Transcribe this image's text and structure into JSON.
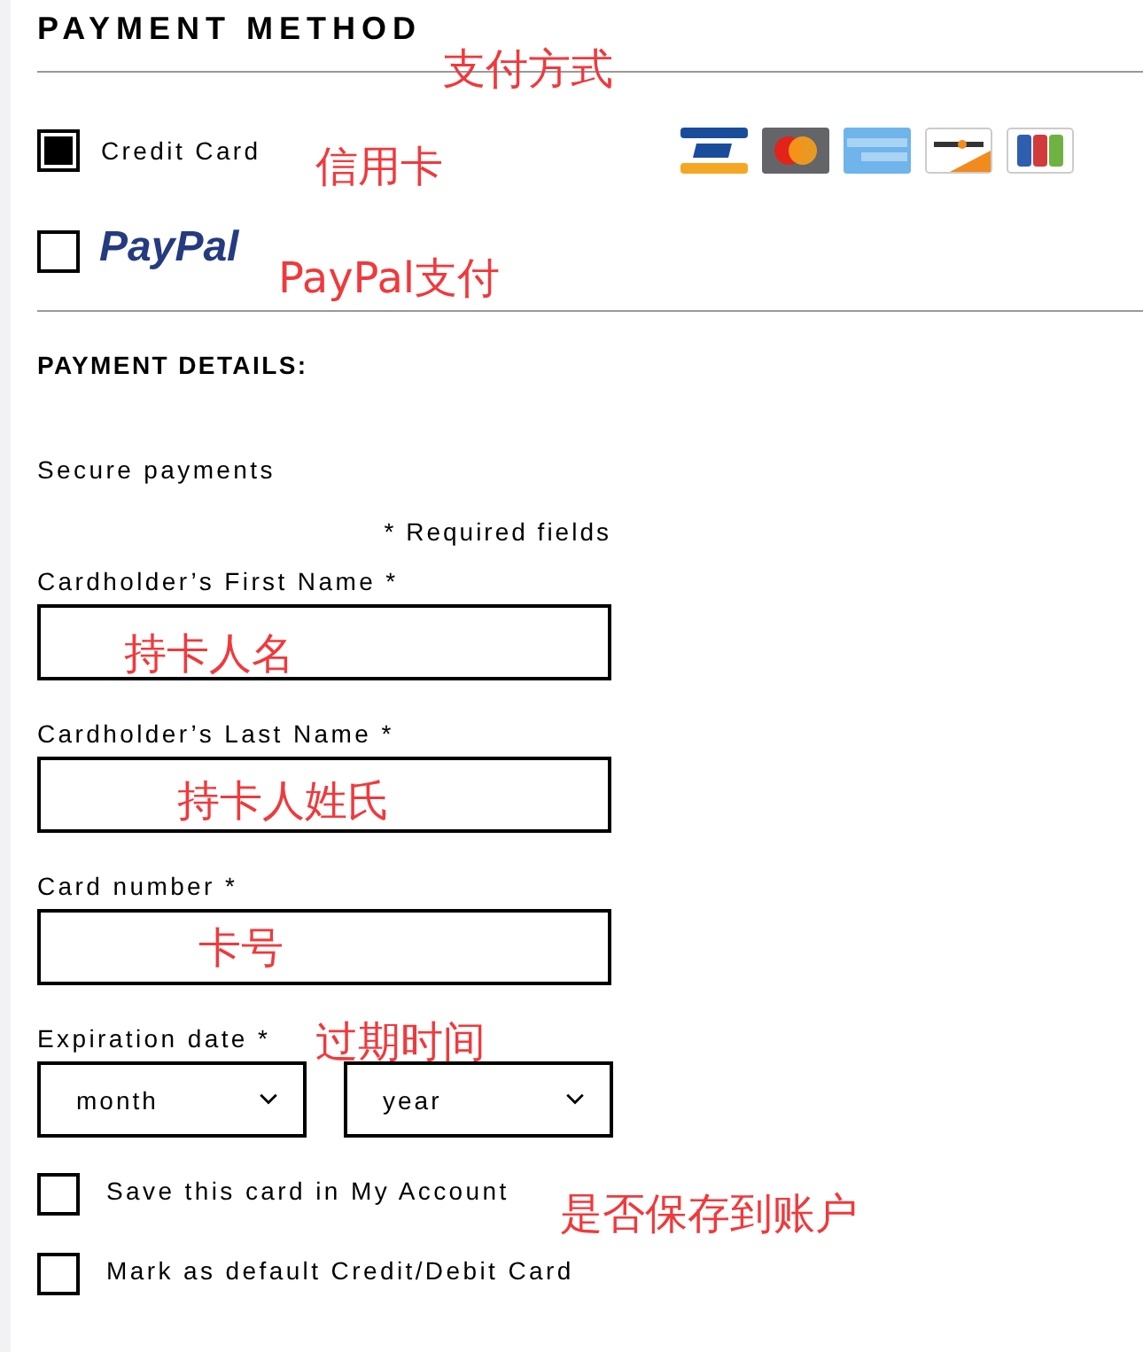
{
  "section_title": "PAYMENT METHOD",
  "methods": [
    {
      "kind": "card",
      "label": "Credit Card",
      "selected": true
    },
    {
      "kind": "paypal",
      "label": "PayPal",
      "selected": false
    }
  ],
  "details_title": "PAYMENT DETAILS:",
  "secure_note": "Secure payments",
  "required_note": "* Required fields",
  "fields": [
    {
      "label": "Cardholder’s First Name *"
    },
    {
      "label": "Cardholder’s Last Name *"
    },
    {
      "label": "Card number *"
    }
  ],
  "expiration": {
    "label": "Expiration date *",
    "selects": [
      {
        "value": "month"
      },
      {
        "value": "year"
      }
    ]
  },
  "options": [
    {
      "label": "Save this card in My Account",
      "checked": false
    },
    {
      "label": "Mark as default Credit/Debit Card",
      "checked": false
    }
  ],
  "annotations": [
    {
      "text": "支付方式"
    },
    {
      "text": "信用卡"
    },
    {
      "text": "PayPal支付"
    },
    {
      "text": "持卡人名"
    },
    {
      "text": "持卡人姓氏"
    },
    {
      "text": "卡号"
    },
    {
      "text": "过期时间"
    },
    {
      "text": "是否保存到账户"
    }
  ]
}
